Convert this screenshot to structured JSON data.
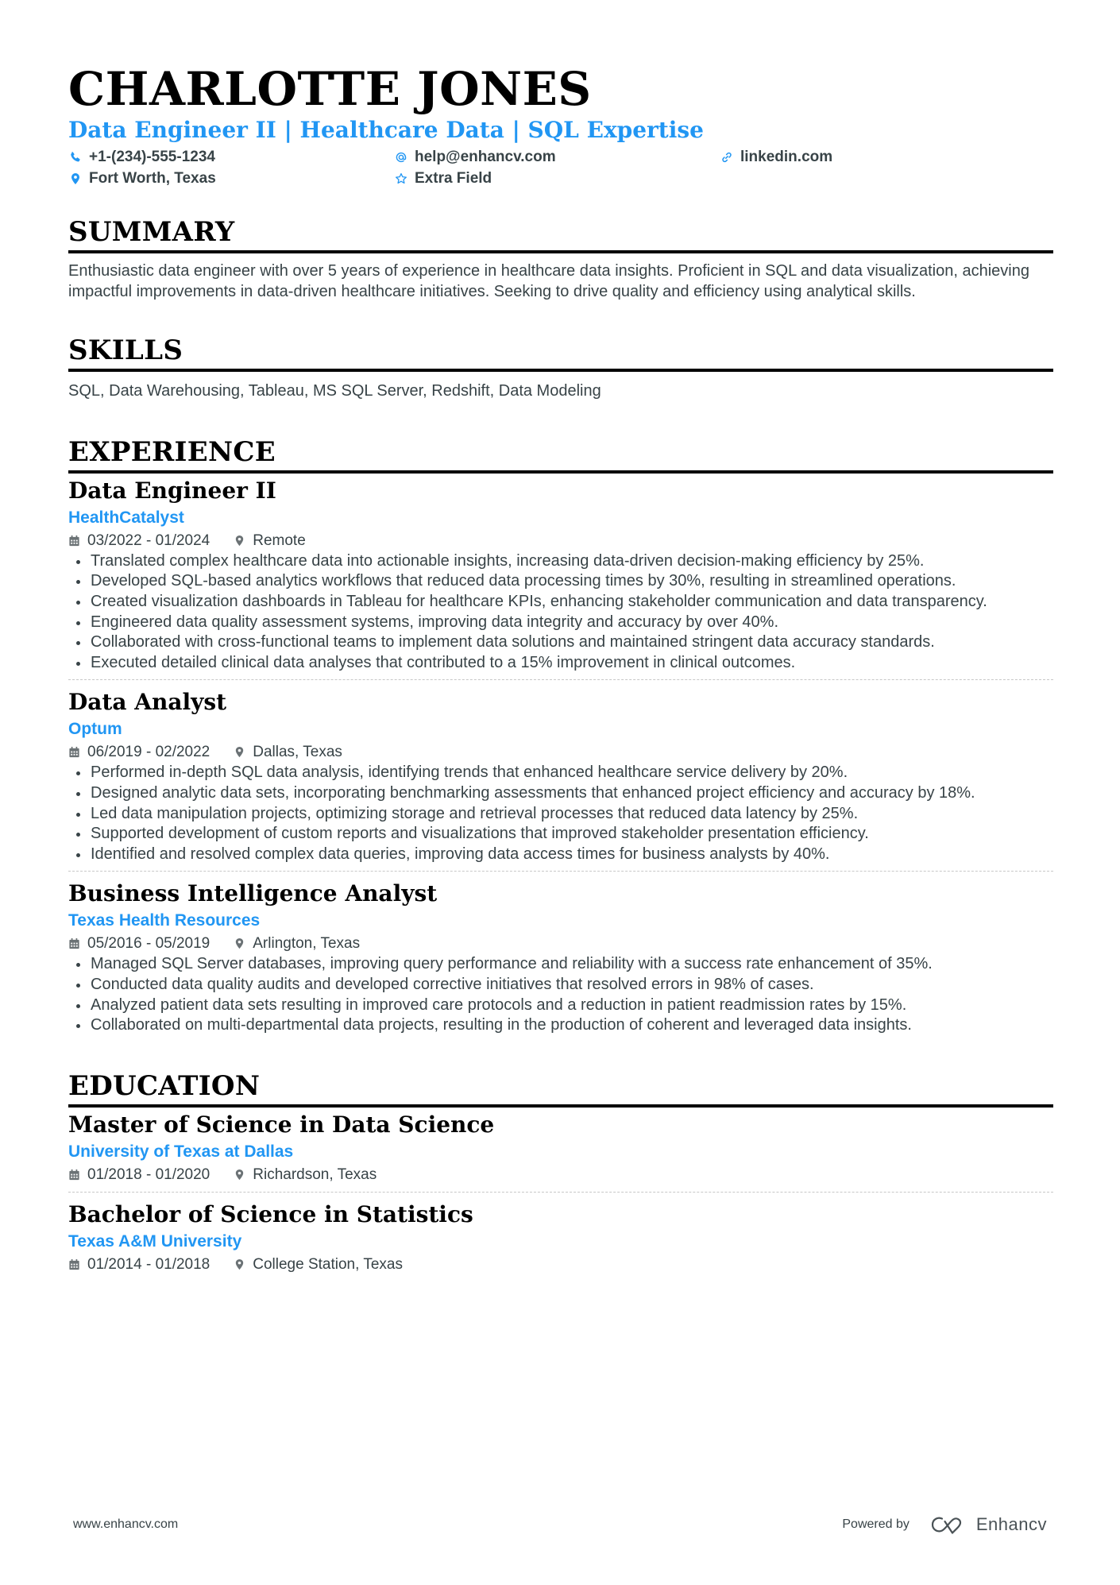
{
  "header": {
    "name": "CHARLOTTE JONES",
    "headline": "Data Engineer II | Healthcare Data | SQL Expertise",
    "contacts": [
      {
        "icon": "phone-icon",
        "text": "+1-(234)-555-1234"
      },
      {
        "icon": "at-icon",
        "text": "help@enhancv.com"
      },
      {
        "icon": "link-icon",
        "text": "linkedin.com"
      },
      {
        "icon": "location-icon",
        "text": "Fort Worth, Texas"
      },
      {
        "icon": "star-icon",
        "text": "Extra Field"
      }
    ]
  },
  "summary": {
    "title": "SUMMARY",
    "text": "Enthusiastic data engineer with over 5 years of experience in healthcare data insights. Proficient in SQL and data visualization, achieving impactful improvements in data-driven healthcare initiatives. Seeking to drive quality and efficiency using analytical skills."
  },
  "skills": {
    "title": "SKILLS",
    "text": "SQL, Data Warehousing, Tableau, MS SQL Server, Redshift, Data Modeling"
  },
  "experience": {
    "title": "EXPERIENCE",
    "items": [
      {
        "role": "Data Engineer II",
        "company": "HealthCatalyst",
        "dates": "03/2022 - 01/2024",
        "location": "Remote",
        "bullets": [
          "Translated complex healthcare data into actionable insights, increasing data-driven decision-making efficiency by 25%.",
          "Developed SQL-based analytics workflows that reduced data processing times by 30%, resulting in streamlined operations.",
          "Created visualization dashboards in Tableau for healthcare KPIs, enhancing stakeholder communication and data transparency.",
          "Engineered data quality assessment systems, improving data integrity and accuracy by over 40%.",
          "Collaborated with cross-functional teams to implement data solutions and maintained stringent data accuracy standards.",
          "Executed detailed clinical data analyses that contributed to a 15% improvement in clinical outcomes."
        ]
      },
      {
        "role": "Data Analyst",
        "company": "Optum",
        "dates": "06/2019 - 02/2022",
        "location": "Dallas, Texas",
        "bullets": [
          "Performed in-depth SQL data analysis, identifying trends that enhanced healthcare service delivery by 20%.",
          "Designed analytic data sets, incorporating benchmarking assessments that enhanced project efficiency and accuracy by 18%.",
          "Led data manipulation projects, optimizing storage and retrieval processes that reduced data latency by 25%.",
          "Supported development of custom reports and visualizations that improved stakeholder presentation efficiency.",
          "Identified and resolved complex data queries, improving data access times for business analysts by 40%."
        ]
      },
      {
        "role": "Business Intelligence Analyst",
        "company": "Texas Health Resources",
        "dates": "05/2016 - 05/2019",
        "location": "Arlington, Texas",
        "bullets": [
          "Managed SQL Server databases, improving query performance and reliability with a success rate enhancement of 35%.",
          "Conducted data quality audits and developed corrective initiatives that resolved errors in 98% of cases.",
          "Analyzed patient data sets resulting in improved care protocols and a reduction in patient readmission rates by 15%.",
          "Collaborated on multi-departmental data projects, resulting in the production of coherent and leveraged data insights."
        ]
      }
    ]
  },
  "education": {
    "title": "EDUCATION",
    "items": [
      {
        "degree": "Master of Science in Data Science",
        "school": "University of Texas at Dallas",
        "dates": "01/2018 - 01/2020",
        "location": "Richardson, Texas"
      },
      {
        "degree": "Bachelor of Science in Statistics",
        "school": "Texas A&M University",
        "dates": "01/2014 - 01/2018",
        "location": "College Station, Texas"
      }
    ]
  },
  "footer": {
    "website": "www.enhancv.com",
    "powered_by": "Powered by",
    "brand": "Enhancv"
  },
  "colors": {
    "accent": "#2196f3",
    "text": "#384347",
    "heading": "#000000"
  }
}
